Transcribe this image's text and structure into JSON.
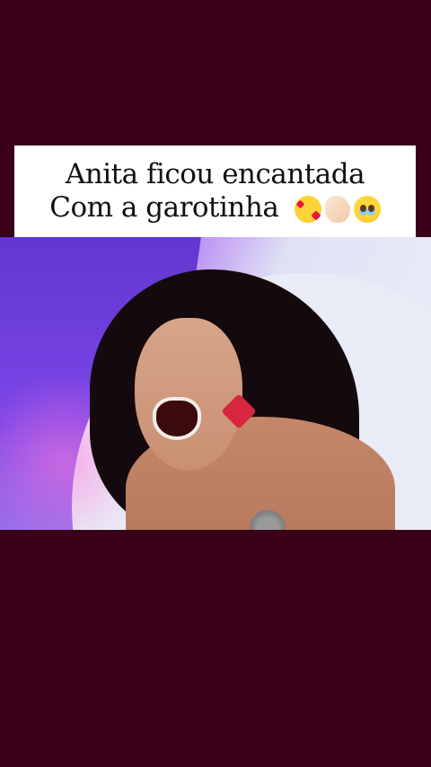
{
  "caption": {
    "line1": "Anita ficou encantada",
    "line2": "Com a garotinha",
    "emojis": [
      "smiling-face-with-hearts",
      "clapping-hands",
      "face-holding-back-tears"
    ]
  },
  "colors": {
    "background": "#3a0018",
    "caption_background": "#ffffff",
    "caption_text": "#111111"
  }
}
